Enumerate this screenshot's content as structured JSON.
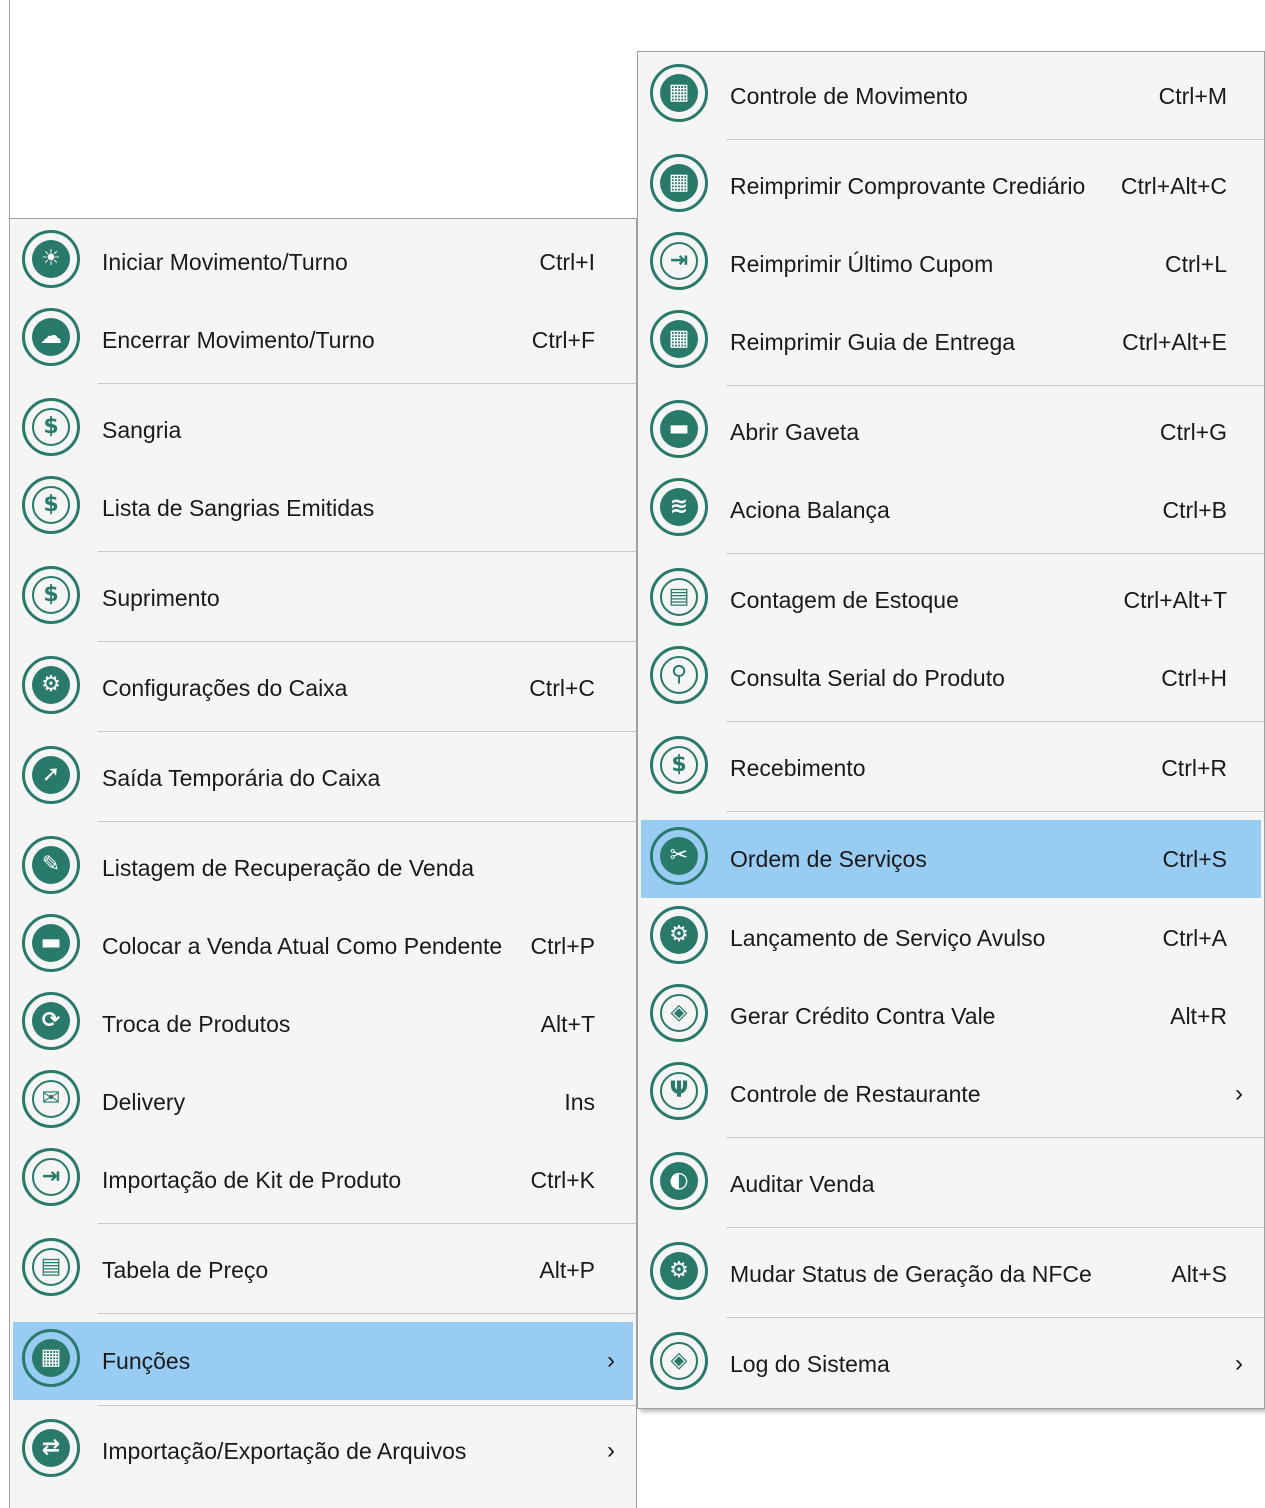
{
  "colors": {
    "highlight": "#99ccf3",
    "icon": "#2a7a6c",
    "menu_bg": "#f5f5f5"
  },
  "left_menu": {
    "items": [
      {
        "label": "Iniciar Movimento/Turno",
        "shortcut": "Ctrl+I",
        "icon": "sun-icon"
      },
      {
        "label": "Encerrar Movimento/Turno",
        "shortcut": "Ctrl+F",
        "icon": "cloud-sun-icon"
      },
      {
        "label": "Sangria",
        "shortcut": "",
        "icon": "dollar-minus-icon"
      },
      {
        "label": "Lista de Sangrias Emitidas",
        "shortcut": "",
        "icon": "dollar-minus-icon"
      },
      {
        "label": "Suprimento",
        "shortcut": "",
        "icon": "dollar-plus-icon"
      },
      {
        "label": "Configurações do Caixa",
        "shortcut": "Ctrl+C",
        "icon": "gear-wrench-icon"
      },
      {
        "label": "Saída Temporária do Caixa",
        "shortcut": "",
        "icon": "exit-icon"
      },
      {
        "label": "Listagem de Recuperação de Venda",
        "shortcut": "",
        "icon": "edit-list-icon"
      },
      {
        "label": "Colocar a Venda Atual Como Pendente",
        "shortcut": "Ctrl+P",
        "icon": "drawer-icon"
      },
      {
        "label": "Troca de Produtos",
        "shortcut": "Alt+T",
        "icon": "exchange-icon"
      },
      {
        "label": "Delivery",
        "shortcut": "Ins",
        "icon": "delivery-icon"
      },
      {
        "label": "Importação de Kit de Produto",
        "shortcut": "Ctrl+K",
        "icon": "import-icon"
      },
      {
        "label": "Tabela de Preço",
        "shortcut": "Alt+P",
        "icon": "clipboard-icon"
      },
      {
        "label": "Funções",
        "shortcut": "",
        "icon": "cart-icon",
        "submenu": "›"
      },
      {
        "label": "Importação/Exportação de Arquivos",
        "shortcut": "",
        "icon": "shuffle-icon",
        "submenu": "›"
      }
    ]
  },
  "right_menu": {
    "items": [
      {
        "label": "Controle de Movimento",
        "shortcut": "Ctrl+M",
        "icon": "calculator-icon"
      },
      {
        "label": "Reimprimir Comprovante Crediário",
        "shortcut": "Ctrl+Alt+C",
        "icon": "calculator-icon"
      },
      {
        "label": "Reimprimir Último Cupom",
        "shortcut": "Ctrl+L",
        "icon": "import-icon"
      },
      {
        "label": "Reimprimir Guia de Entrega",
        "shortcut": "Ctrl+Alt+E",
        "icon": "calculator-icon"
      },
      {
        "label": "Abrir Gaveta",
        "shortcut": "Ctrl+G",
        "icon": "drawer-icon"
      },
      {
        "label": "Aciona Balança",
        "shortcut": "Ctrl+B",
        "icon": "layers-icon"
      },
      {
        "label": "Contagem de Estoque",
        "shortcut": "Ctrl+Alt+T",
        "icon": "clipboard-icon"
      },
      {
        "label": "Consulta Serial do Produto",
        "shortcut": "Ctrl+H",
        "icon": "search-icon"
      },
      {
        "label": "Recebimento",
        "shortcut": "Ctrl+R",
        "icon": "dollar-plus-icon"
      },
      {
        "label": "Ordem de Serviços",
        "shortcut": "Ctrl+S",
        "icon": "tools-icon"
      },
      {
        "label": "Lançamento de Serviço Avulso",
        "shortcut": "Ctrl+A",
        "icon": "gear-wrench-icon"
      },
      {
        "label": "Gerar Crédito Contra Vale",
        "shortcut": "Alt+R",
        "icon": "voucher-icon"
      },
      {
        "label": "Controle de Restaurante",
        "shortcut": "",
        "icon": "fork-knife-icon",
        "submenu": "›"
      },
      {
        "label": "Auditar Venda",
        "shortcut": "",
        "icon": "audit-icon"
      },
      {
        "label": "Mudar Status de Geração da NFCe",
        "shortcut": "Alt+S",
        "icon": "gear-wrench-icon"
      },
      {
        "label": "Log do Sistema",
        "shortcut": "",
        "icon": "voucher-icon",
        "submenu": "›"
      }
    ]
  }
}
